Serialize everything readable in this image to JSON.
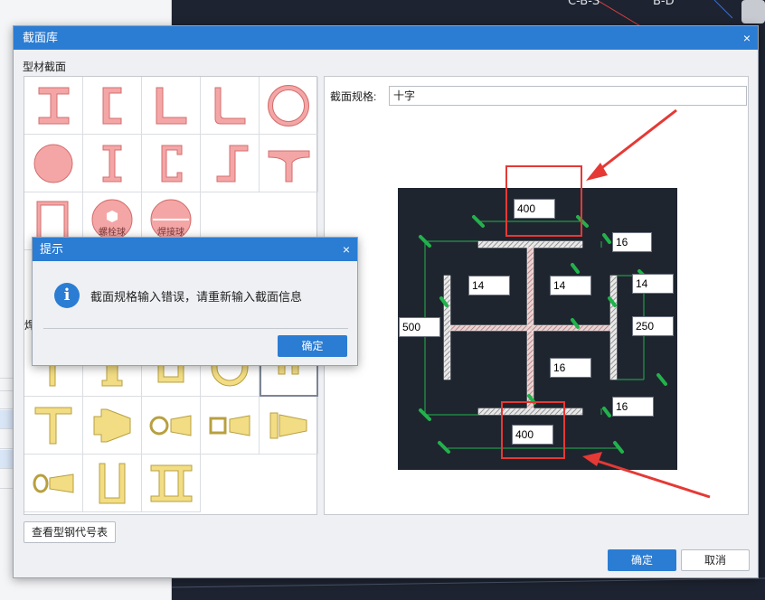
{
  "background": {
    "cad_labels": [
      "C-B-S",
      "B-D"
    ]
  },
  "dialog": {
    "title": "截面库",
    "close_glyph": "×",
    "group_label": "型材截面",
    "weld_label": "焊",
    "profile_tiles": [
      {
        "icon": "i-beam-icon"
      },
      {
        "icon": "channel-icon"
      },
      {
        "icon": "angle-icon"
      },
      {
        "icon": "angle-round-icon"
      },
      {
        "icon": "pipe-icon"
      },
      {
        "icon": "solid-round-icon"
      },
      {
        "icon": "i-beam-simple-icon"
      },
      {
        "icon": "channel-thin-icon"
      },
      {
        "icon": "z-section-icon"
      },
      {
        "icon": "tee-icon"
      },
      {
        "icon": "rect-tube-icon"
      },
      {
        "icon": "bolt-ball-icon",
        "label": "螺栓球"
      },
      {
        "icon": "weld-ball-icon",
        "label": "焊接球"
      }
    ],
    "spec_label": "截面规格:",
    "spec_value": "十字",
    "dimensions": {
      "top_flange_width": "400",
      "bottom_flange_width": "400",
      "top_flange_thickness": "16",
      "bottom_flange_thickness": "16",
      "left_web_thickness": "14",
      "center_web_thickness": "14",
      "right_web_thickness": "14",
      "total_height": "500",
      "side_height": "250",
      "center_thickness": "16"
    },
    "view_table_button": "查看型钢代号表",
    "ok_button": "确定",
    "cancel_button": "取消"
  },
  "alert": {
    "title": "提示",
    "close_glyph": "×",
    "icon": "info-icon",
    "message": "截面规格输入错误，请重新输入截面信息",
    "ok_button": "确定"
  },
  "colors": {
    "accent": "#2b7cd3",
    "profile_fill": "#f4a6a6",
    "weld_fill": "#f2dd84",
    "annotation_red": "#e53935",
    "dimension_green": "#22b24c"
  }
}
